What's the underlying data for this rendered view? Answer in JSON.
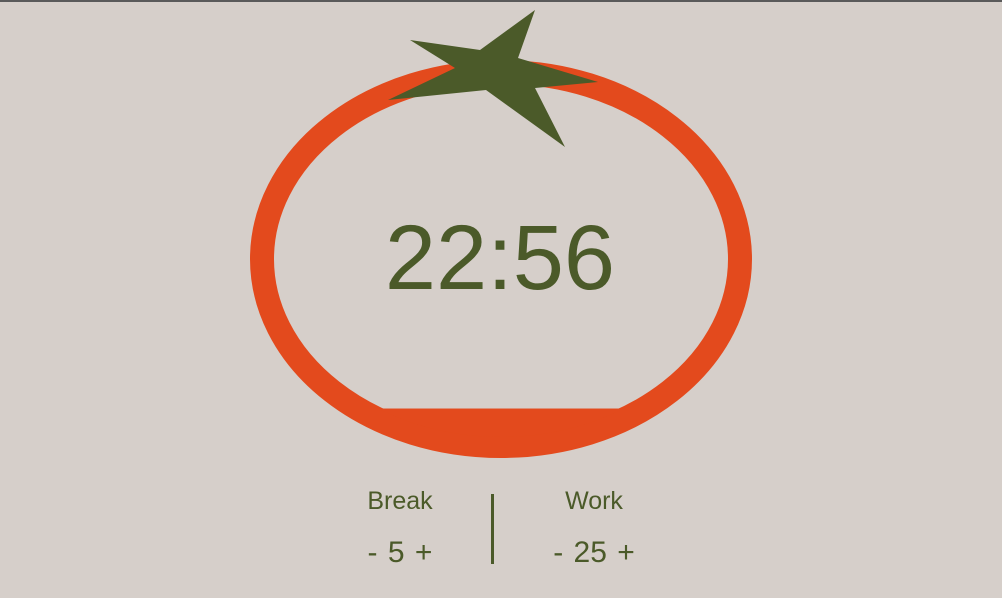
{
  "colors": {
    "background": "#d6cfca",
    "tomato_ring": "#e34a1d",
    "stem": "#4b5a29",
    "text": "#4b5a29"
  },
  "timer": {
    "display": "22:56",
    "fill_fraction": 0.08
  },
  "break": {
    "label": "Break",
    "decrement": "-",
    "value": "5",
    "increment": "+"
  },
  "work": {
    "label": "Work",
    "decrement": "-",
    "value": "25",
    "increment": "+"
  },
  "icons": {
    "stem": "tomato-stem-icon",
    "tomato": "tomato-ring-icon"
  }
}
